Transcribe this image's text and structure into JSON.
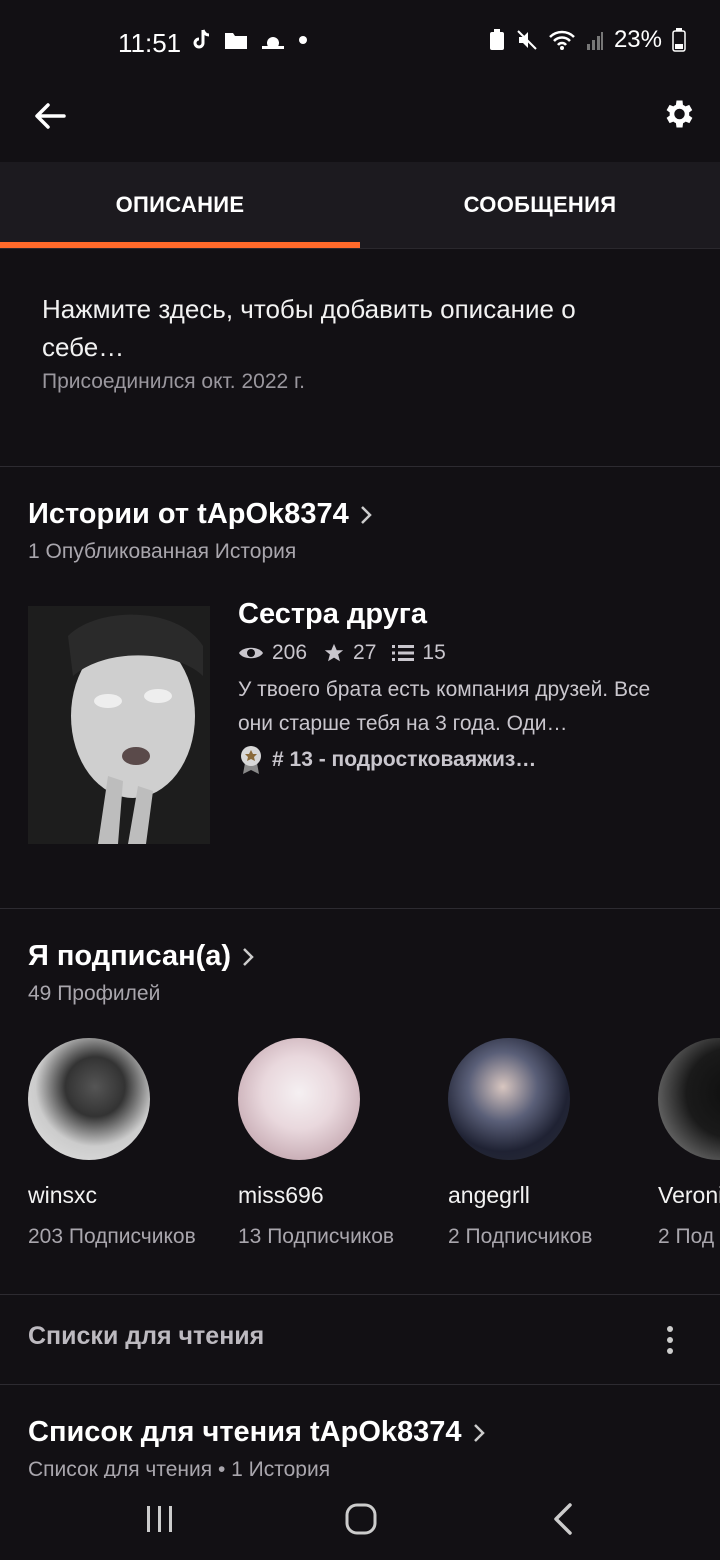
{
  "status_bar": {
    "time": "11:51",
    "battery": "23%"
  },
  "tabs": [
    {
      "label": "ОПИСАНИЕ",
      "active": true
    },
    {
      "label": "СООБЩЕНИЯ",
      "active": false
    }
  ],
  "about": {
    "text": "Нажмите здесь, чтобы добавить описание о себе…",
    "joined": "Присоединился окт. 2022 г."
  },
  "stories": {
    "title": "Истории от tApOk8374",
    "subtitle": "1 Опубликованная История",
    "item": {
      "title": "Сестра друга",
      "views": "206",
      "votes": "27",
      "parts": "15",
      "description": "У твоего брата есть компания друзей. Все они старше тебя на 3 года. Оди…",
      "tag": "# 13 - подростковаяжиз…"
    }
  },
  "following": {
    "title": "Я подписан(а)",
    "subtitle": "49 Профилей",
    "profiles": [
      {
        "name": "winsxc",
        "followers": "203 Подписчиков"
      },
      {
        "name": "miss696",
        "followers": "13 Подписчиков"
      },
      {
        "name": "angegrll",
        "followers": "2 Подписчиков"
      },
      {
        "name": "Veroni",
        "followers": "2 Под"
      }
    ]
  },
  "reading_lists": {
    "label": "Списки для чтения",
    "list_title": "Список для чтения tApOk8374",
    "list_subtitle": "Список для чтения • 1 История"
  },
  "colors": {
    "accent": "#ff6a2b",
    "background": "#121014"
  }
}
